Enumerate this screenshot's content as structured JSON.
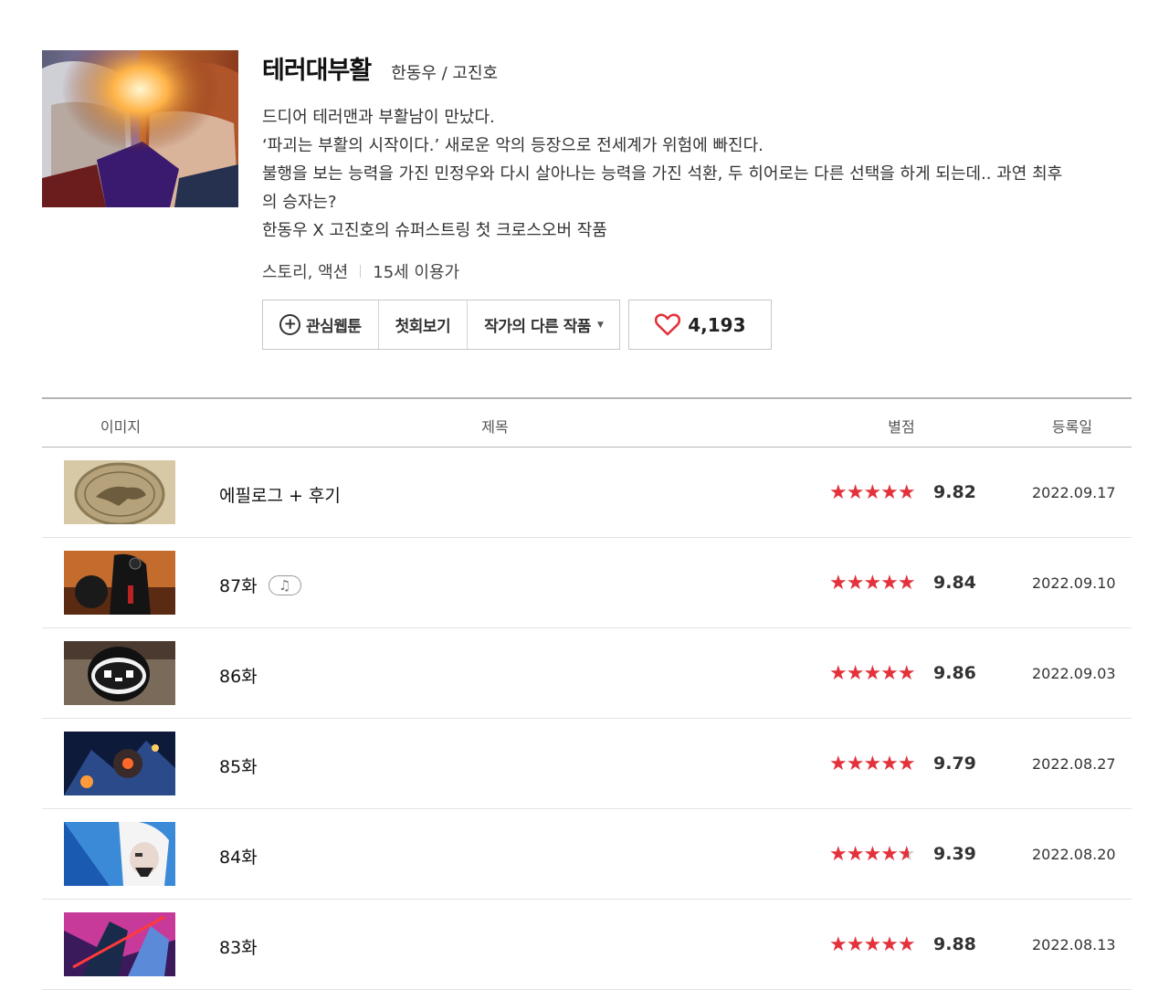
{
  "webtoon": {
    "title": "테러대부활",
    "authors": "한동우 / 고진호",
    "synopsis": [
      "드디어 테러맨과 부활남이 만났다.",
      "‘파괴는 부활의 시작이다.’ 새로운 악의 등장으로 전세계가 위험에 빠진다.",
      "불행을 보는 능력을 가진 민정우와 다시 살아나는 능력을 가진 석환, 두 히어로는 다른 선택을 하게 되는데.. 과연 최후",
      "의 승자는?",
      "한동우 X 고진호의 슈퍼스트링 첫 크로스오버 작품"
    ],
    "genre": "스토리, 액션",
    "age_rating": "15세 이용가"
  },
  "actions": {
    "favorite_label": "관심웹툰",
    "first_episode_label": "첫회보기",
    "other_works_label": "작가의 다른 작품",
    "like_count": "4,193"
  },
  "table": {
    "headers": {
      "image": "이미지",
      "title": "제목",
      "rating": "별점",
      "date": "등록일"
    },
    "episodes": [
      {
        "title": "에필로그 + 후기",
        "rating": "9.82",
        "stars": 5,
        "date": "2022.09.17",
        "bgm": false
      },
      {
        "title": "87화",
        "rating": "9.84",
        "stars": 5,
        "date": "2022.09.10",
        "bgm": true
      },
      {
        "title": "86화",
        "rating": "9.86",
        "stars": 5,
        "date": "2022.09.03",
        "bgm": false
      },
      {
        "title": "85화",
        "rating": "9.79",
        "stars": 5,
        "date": "2022.08.27",
        "bgm": false
      },
      {
        "title": "84화",
        "rating": "9.39",
        "stars": 4.5,
        "date": "2022.08.20",
        "bgm": false
      },
      {
        "title": "83화",
        "rating": "9.88",
        "stars": 5,
        "date": "2022.08.13",
        "bgm": false
      }
    ]
  },
  "colors": {
    "star": "#e3323b",
    "heart": "#e3323b",
    "border": "#c8c8c8"
  },
  "icons": {
    "favorite": "plus-circle-icon",
    "dropdown": "caret-down-icon",
    "like": "heart-icon",
    "bgm": "music-note-icon",
    "rating": "star-icon"
  }
}
